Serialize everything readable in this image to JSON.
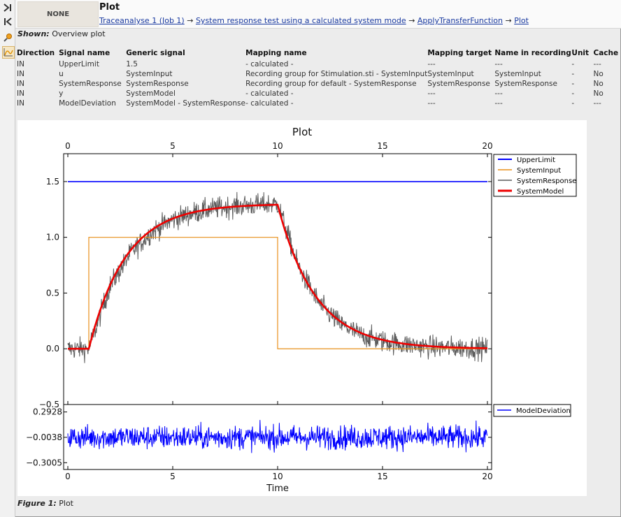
{
  "header": {
    "none_label": "NONE",
    "title": "Plot",
    "breadcrumb": [
      "Traceanalyse 1 (Job 1)",
      "System response test using a calculated system mode",
      "ApplyTransferFunction",
      "Plot"
    ]
  },
  "shown": {
    "label": "Shown:",
    "value": "Overview plot"
  },
  "signal_table": {
    "columns": [
      "Direction",
      "Signal name",
      "Generic signal",
      "Mapping name",
      "Mapping target",
      "Name in recording",
      "Unit",
      "Cache"
    ],
    "rows": [
      [
        "IN",
        "UpperLimit",
        "1.5",
        "- calculated -",
        "---",
        "---",
        "-",
        "---"
      ],
      [
        "IN",
        "u",
        "SystemInput",
        "Recording group for Stimulation.sti - SystemInput",
        "SystemInput",
        "SystemInput",
        "-",
        "No"
      ],
      [
        "IN",
        "SystemResponse",
        "SystemResponse",
        "Recording group for default - SystemResponse",
        "SystemResponse",
        "SystemResponse",
        "-",
        "No"
      ],
      [
        "IN",
        "y",
        "SystemModel",
        "- calculated -",
        "---",
        "---",
        "-",
        "No"
      ],
      [
        "IN",
        "ModelDeviation",
        "SystemModel - SystemResponse",
        "- calculated -",
        "---",
        "---",
        "-",
        "---"
      ]
    ]
  },
  "figure_caption": {
    "label": "Figure 1:",
    "value": "Plot"
  },
  "colors": {
    "upper_limit": "#0000ff",
    "system_input": "#e8901a",
    "system_response": "#5c5c5c",
    "system_model": "#ee0000",
    "model_deviation": "#0000ff"
  },
  "chart_data": [
    {
      "type": "line",
      "title": "Plot",
      "xlim": [
        0,
        20
      ],
      "ylim": [
        -0.5,
        1.75
      ],
      "x_ticks": [
        "0",
        "5",
        "10",
        "15",
        "20"
      ],
      "y_ticks": [
        "-0.5",
        "0.0",
        "0.5",
        "1.0",
        "1.5"
      ],
      "grid": false,
      "legend": "top-right, outside",
      "series": [
        {
          "name": "UpperLimit",
          "x": [
            0,
            20
          ],
          "y": [
            1.5,
            1.5
          ]
        },
        {
          "name": "SystemInput",
          "x": [
            0,
            1,
            1,
            10,
            10,
            20
          ],
          "y": [
            0,
            0,
            1,
            1,
            0,
            0
          ]
        },
        {
          "name": "SystemResponse",
          "x": [
            0,
            1,
            2,
            3,
            4,
            5,
            6,
            7,
            8,
            9,
            10,
            11,
            12,
            13,
            14,
            15,
            16,
            17,
            18,
            19,
            20
          ],
          "y": [
            0.0,
            0.0,
            0.56,
            0.86,
            1.05,
            1.16,
            1.22,
            1.26,
            1.28,
            1.29,
            1.3,
            0.73,
            0.4,
            0.22,
            0.12,
            0.07,
            0.04,
            0.02,
            0.01,
            0.01,
            0.0
          ],
          "noise": "approximately ±0.15 around the model"
        },
        {
          "name": "SystemModel",
          "x": [
            0,
            1,
            2,
            3,
            4,
            5,
            6,
            7,
            8,
            9,
            10,
            11,
            12,
            13,
            14,
            15,
            16,
            17,
            18,
            19,
            20
          ],
          "y": [
            0.0,
            0.0,
            0.56,
            0.86,
            1.05,
            1.16,
            1.22,
            1.26,
            1.28,
            1.29,
            1.3,
            0.73,
            0.4,
            0.22,
            0.12,
            0.07,
            0.04,
            0.02,
            0.01,
            0.01,
            0.0
          ]
        }
      ]
    },
    {
      "type": "line",
      "xlabel": "Time",
      "xlim": [
        0,
        20
      ],
      "ylim": [
        -0.38,
        0.38
      ],
      "x_ticks": [
        "0",
        "5",
        "10",
        "15",
        "20"
      ],
      "y_ticks": [
        "0.2928",
        "−0.0038",
        "−0.3005"
      ],
      "legend": "top-right, outside",
      "series": [
        {
          "name": "ModelDeviation",
          "x": [
            0,
            20
          ],
          "y_mean": -0.0038,
          "y_range": [
            -0.3005,
            0.2928
          ]
        }
      ]
    }
  ]
}
